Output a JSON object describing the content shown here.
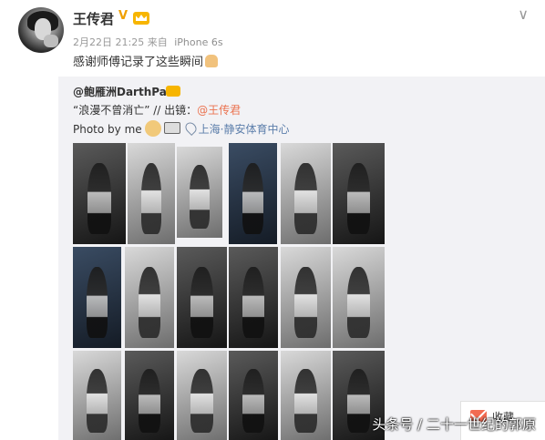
{
  "post": {
    "author": "王传君",
    "verified_mark": "V",
    "meta_time": "2月22日 21:25",
    "meta_from": "来自",
    "meta_device": "iPhone 6s",
    "text": "感谢师傅记录了这些瞬间"
  },
  "repost": {
    "author": "@鲍雁洲DarthPau",
    "line2_text": "“浪漫不曾消亡” // 出镜：",
    "line2_mention": "@王传君",
    "line3_text": "Photo by me",
    "location": "上海·静安体育中心"
  },
  "footer": {
    "collect_label": "收藏",
    "watermark": "头条号 / 二十一世纪的郭原"
  },
  "icons": {
    "avatar": "avatar-photo",
    "badge": "crown-badge",
    "chevron": "chevron-down-icon",
    "location": "pin-icon",
    "doge": "doge-emoji",
    "card": "card-icon",
    "pray": "pray-emoji",
    "mail": "mail-icon"
  },
  "colors": {
    "repost_bg": "#f2f2f5",
    "mention": "#eb7350",
    "location": "#5d7fab",
    "muted": "#999999"
  }
}
